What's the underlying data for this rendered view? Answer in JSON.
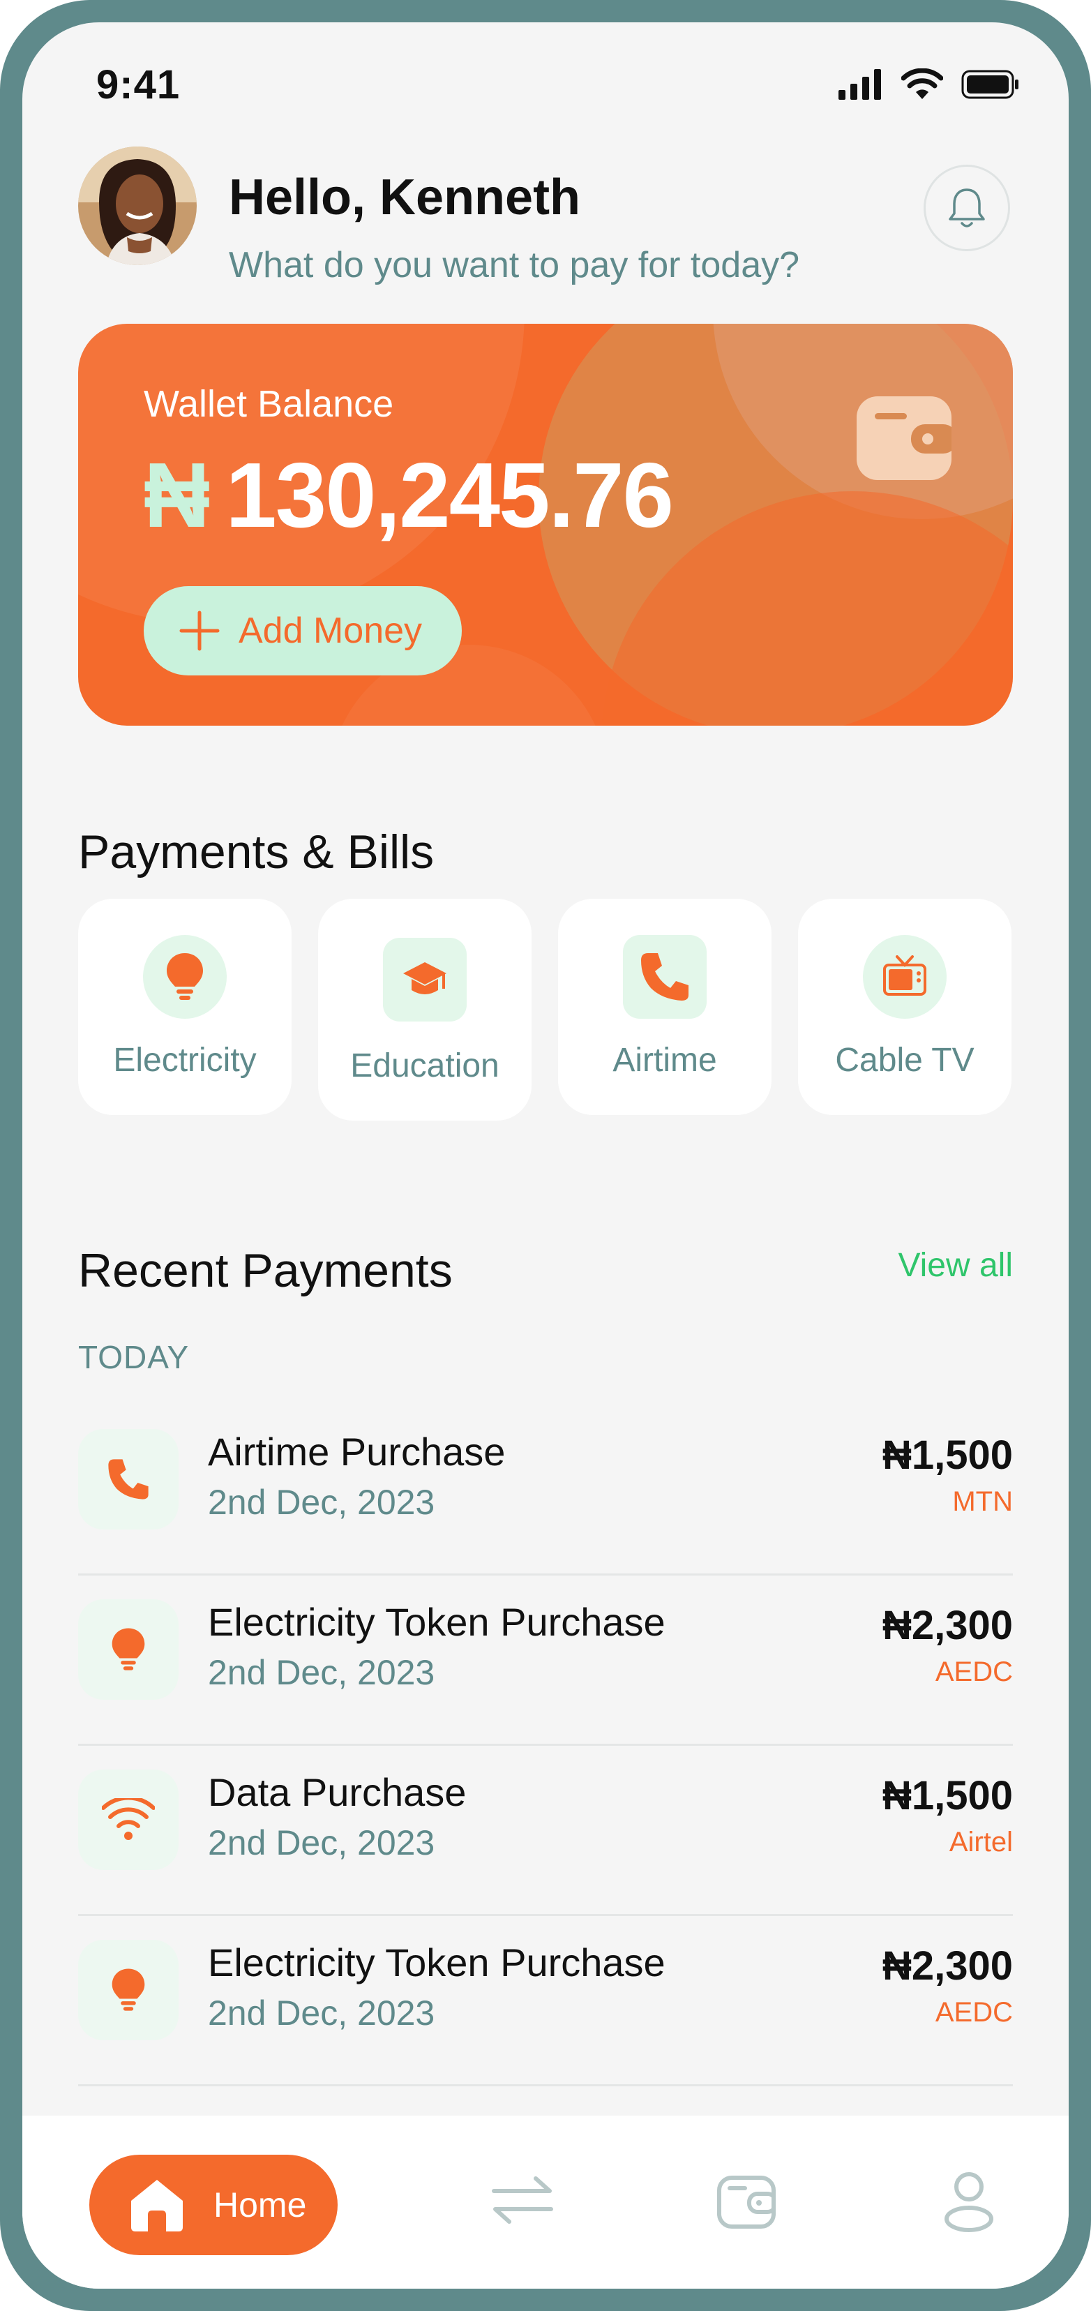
{
  "status_bar": {
    "time": "9:41"
  },
  "header": {
    "greeting": "Hello, Kenneth",
    "subtitle": "What do you want to pay for today?"
  },
  "wallet": {
    "label": "Wallet Balance",
    "currency_symbol": "₦",
    "amount": "130,245.76",
    "add_money_label": "Add Money"
  },
  "payments_bills": {
    "title": "Payments & Bills",
    "items": [
      {
        "label": "Electricity",
        "icon": "lightbulb-icon"
      },
      {
        "label": "Education",
        "icon": "graduation-cap-icon"
      },
      {
        "label": "Airtime",
        "icon": "phone-icon"
      },
      {
        "label": "Cable TV",
        "icon": "tv-icon"
      }
    ]
  },
  "recent_payments": {
    "title": "Recent Payments",
    "view_all": "View all",
    "group_label": "TODAY",
    "items": [
      {
        "title": "Airtime Purchase",
        "date": "2nd Dec, 2023",
        "amount": "₦1,500",
        "provider": "MTN",
        "icon": "phone-icon"
      },
      {
        "title": "Electricity Token Purchase",
        "date": "2nd Dec, 2023",
        "amount": "₦2,300",
        "provider": "AEDC",
        "icon": "lightbulb-icon"
      },
      {
        "title": "Data Purchase",
        "date": "2nd Dec, 2023",
        "amount": "₦1,500",
        "provider": "Airtel",
        "icon": "wifi-icon"
      },
      {
        "title": "Electricity Token Purchase",
        "date": "2nd Dec, 2023",
        "amount": "₦2,300",
        "provider": "AEDC",
        "icon": "lightbulb-icon"
      }
    ]
  },
  "bottom_nav": {
    "home_label": "Home",
    "items": [
      "home-icon",
      "transfer-icon",
      "wallet-icon",
      "profile-icon"
    ]
  },
  "colors": {
    "accent": "#f46a2c",
    "mint": "#c9f2dc",
    "teal": "#5f8a8b",
    "green": "#2fc56b"
  }
}
